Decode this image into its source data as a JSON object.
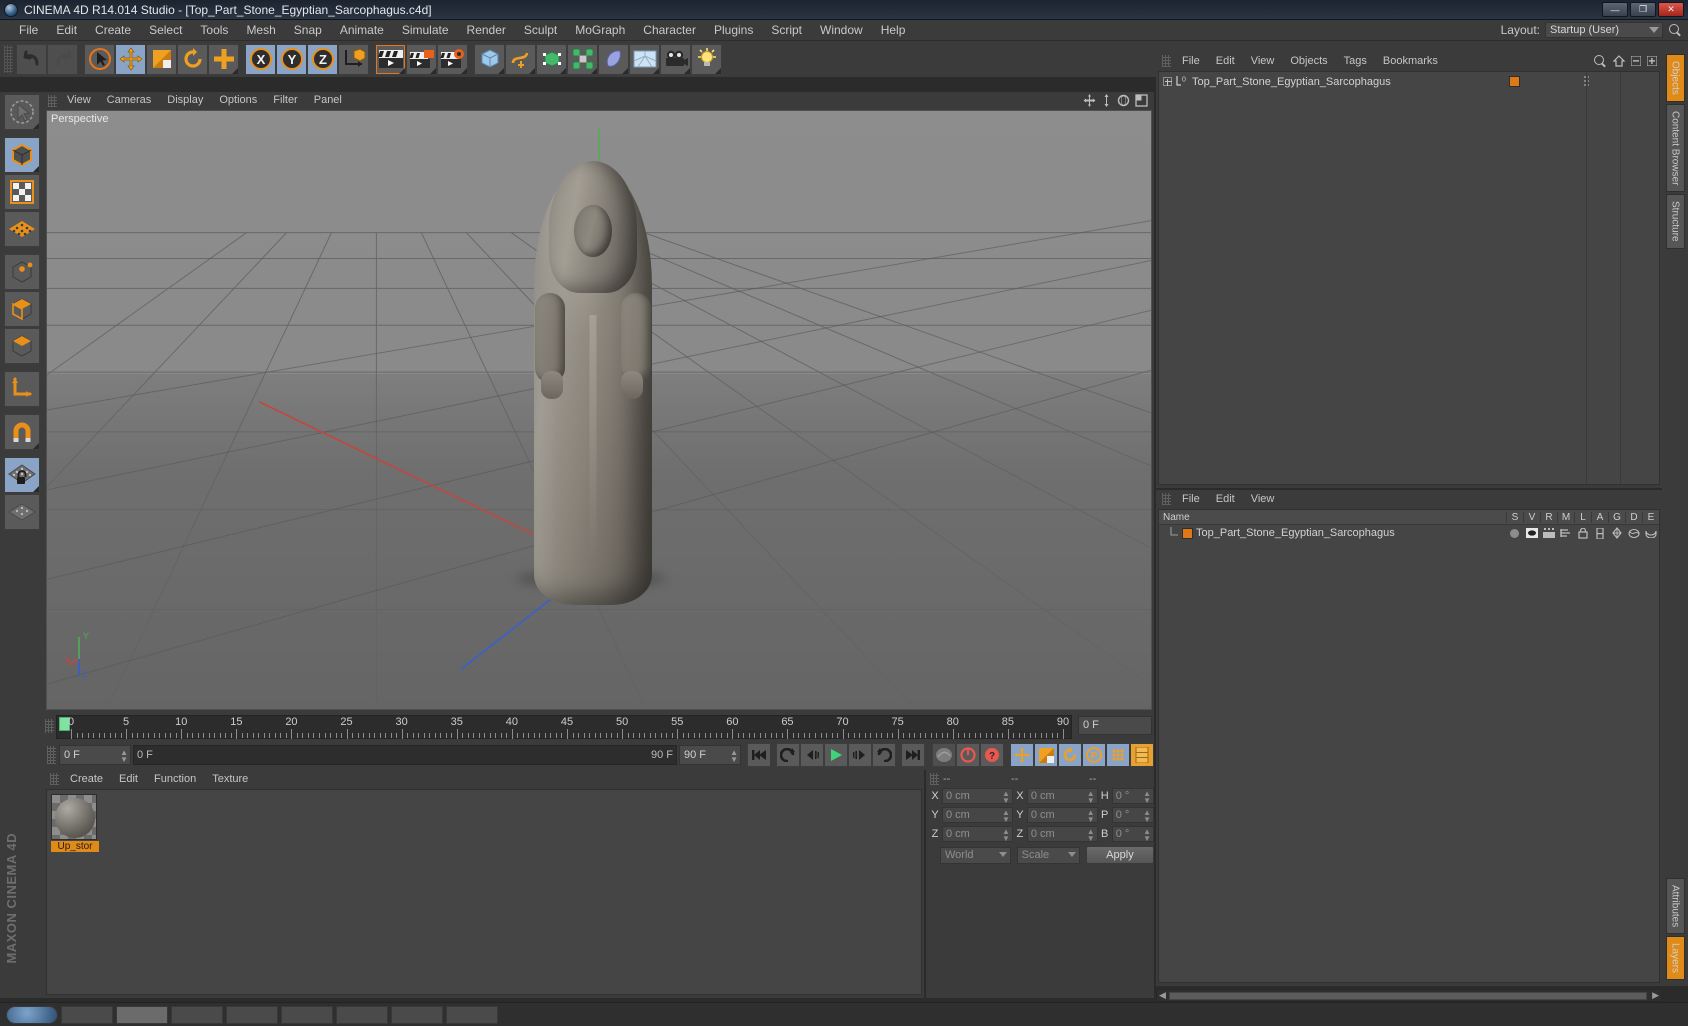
{
  "window": {
    "title": "CINEMA 4D R14.014 Studio - [Top_Part_Stone_Egyptian_Sarcophagus.c4d]",
    "app_icon": "c4d-logo-icon",
    "minimize": "—",
    "maximize": "❐",
    "close": "✕"
  },
  "menubar": {
    "items": [
      "File",
      "Edit",
      "Create",
      "Select",
      "Tools",
      "Mesh",
      "Snap",
      "Animate",
      "Simulate",
      "Render",
      "Sculpt",
      "MoGraph",
      "Character",
      "Plugins",
      "Script",
      "Window",
      "Help"
    ],
    "layout_label": "Layout:",
    "layout_value": "Startup (User)",
    "search_icon": "search-icon"
  },
  "toolbar": {
    "groups": [
      {
        "name": "history",
        "buttons": [
          {
            "icon": "undo-icon",
            "state": "dim",
            "dropdown": false
          },
          {
            "icon": "redo-icon",
            "state": "dim",
            "dropdown": false
          }
        ]
      },
      {
        "name": "transform-tools",
        "buttons": [
          {
            "icon": "select-arrow-icon",
            "state": "normal",
            "dropdown": true
          },
          {
            "icon": "move-icon",
            "state": "active",
            "dropdown": false
          },
          {
            "icon": "scale-icon",
            "state": "normal",
            "dropdown": false
          },
          {
            "icon": "rotate-icon",
            "state": "normal",
            "dropdown": false
          },
          {
            "icon": "plus-axis-icon",
            "state": "normal",
            "dropdown": true
          }
        ]
      },
      {
        "name": "axis-locks",
        "buttons": [
          {
            "icon": "x-axis-icon",
            "state": "active",
            "dropdown": false
          },
          {
            "icon": "y-axis-icon",
            "state": "active",
            "dropdown": false
          },
          {
            "icon": "z-axis-icon",
            "state": "active",
            "dropdown": false
          },
          {
            "icon": "world-object-axis-icon",
            "state": "normal",
            "dropdown": false
          }
        ]
      },
      {
        "name": "render",
        "buttons": [
          {
            "icon": "render-view-icon",
            "state": "highlight",
            "dropdown": true
          },
          {
            "icon": "render-region-icon",
            "state": "normal",
            "dropdown": true
          },
          {
            "icon": "render-settings-icon",
            "state": "normal",
            "dropdown": true
          }
        ]
      },
      {
        "name": "creation",
        "buttons": [
          {
            "icon": "cube-primitive-icon",
            "state": "normal",
            "dropdown": true
          },
          {
            "icon": "spline-pen-icon",
            "state": "normal",
            "dropdown": true
          },
          {
            "icon": "nurbs-icon",
            "state": "normal",
            "dropdown": true
          },
          {
            "icon": "array-modeling-icon",
            "state": "normal",
            "dropdown": true
          },
          {
            "icon": "deformer-icon",
            "state": "normal",
            "dropdown": true
          },
          {
            "icon": "environment-floor-icon",
            "state": "normal",
            "dropdown": true
          },
          {
            "icon": "camera-icon",
            "state": "normal",
            "dropdown": true
          },
          {
            "icon": "light-icon",
            "state": "normal",
            "dropdown": true
          }
        ]
      }
    ]
  },
  "left_toolbar": {
    "buttons": [
      {
        "icon": "live-selection-icon",
        "state": "normal",
        "dropdown": true
      },
      {
        "icon": "model-mode-icon",
        "state": "active",
        "dropdown": true
      },
      {
        "icon": "texture-mode-icon",
        "state": "normal",
        "dropdown": false
      },
      {
        "icon": "points-mode-icon",
        "state": "normal",
        "dropdown": false
      },
      {
        "icon": "edges-mode-icon",
        "state": "normal",
        "dropdown": false
      },
      {
        "icon": "polygons-mode-icon",
        "state": "normal",
        "dropdown": false
      },
      {
        "icon": "object-axis-mode-icon",
        "state": "normal",
        "dropdown": false
      },
      {
        "icon": "world-coordinates-icon",
        "state": "normal",
        "dropdown": false
      },
      {
        "icon": "magnet-icon",
        "state": "normal",
        "dropdown": true
      },
      {
        "icon": "lock-workplane-icon",
        "state": "active",
        "dropdown": true
      },
      {
        "icon": "workplane-icon",
        "state": "normal",
        "dropdown": false
      }
    ],
    "brand": "MAXON CINEMA 4D"
  },
  "viewport": {
    "menu": [
      "View",
      "Cameras",
      "Display",
      "Options",
      "Filter",
      "Panel"
    ],
    "label": "Perspective",
    "nav_icons": [
      "pan-icon",
      "zoom-icon",
      "rotate-view-icon",
      "maximize-view-icon"
    ],
    "axis_labels": {
      "x": "X",
      "y": "Y",
      "z": "Z"
    },
    "model_name": "Top_Part_Stone_Egyptian_Sarcophagus"
  },
  "timeline": {
    "ticks": [
      0,
      5,
      10,
      15,
      20,
      25,
      30,
      35,
      40,
      45,
      50,
      55,
      60,
      65,
      70,
      75,
      80,
      85,
      90
    ],
    "playhead_frame": "0",
    "end_field": "0 F"
  },
  "transport": {
    "current_frame": "0 F",
    "range_start": "0 F",
    "range_end": "90 F",
    "max_frame": "90 F",
    "buttons": [
      {
        "icon": "go-to-start-icon",
        "state": "normal"
      },
      {
        "icon": "previous-key-icon",
        "state": "normal"
      },
      {
        "icon": "step-back-icon",
        "state": "normal"
      },
      {
        "icon": "play-icon",
        "state": "normal"
      },
      {
        "icon": "step-forward-icon",
        "state": "normal"
      },
      {
        "icon": "next-key-icon",
        "state": "normal"
      },
      {
        "icon": "go-to-end-icon",
        "state": "normal"
      },
      {
        "icon": "record-active-objects-icon",
        "state": "dim"
      },
      {
        "icon": "autokeying-icon",
        "state": "normal"
      },
      {
        "icon": "keyframe-selection-icon",
        "state": "normal"
      },
      {
        "icon": "position-key-icon",
        "state": "active"
      },
      {
        "icon": "scale-key-icon",
        "state": "active"
      },
      {
        "icon": "rotation-key-icon",
        "state": "active"
      },
      {
        "icon": "parameter-key-icon",
        "state": "active"
      },
      {
        "icon": "point-level-animation-icon",
        "state": "active"
      },
      {
        "icon": "layout-key-icon",
        "state": "active"
      }
    ]
  },
  "material_manager": {
    "menu": [
      "Create",
      "Edit",
      "Function",
      "Texture"
    ],
    "materials": [
      {
        "name": "Up_stor",
        "preview": "stone-sphere-preview"
      }
    ]
  },
  "coordinates": {
    "headers": [
      "--",
      "--",
      "--"
    ],
    "rows": [
      {
        "label1": "X",
        "value1": "0 cm",
        "label2": "X",
        "value2": "0 cm",
        "label3": "H",
        "value3": "0 °"
      },
      {
        "label1": "Y",
        "value1": "0 cm",
        "label2": "Y",
        "value2": "0 cm",
        "label3": "P",
        "value3": "0 °"
      },
      {
        "label1": "Z",
        "value1": "0 cm",
        "label2": "Z",
        "value2": "0 cm",
        "label3": "B",
        "value3": "0 °"
      }
    ],
    "system": "World",
    "mode": "Scale",
    "apply": "Apply"
  },
  "object_manager": {
    "menu": [
      "File",
      "Edit",
      "View",
      "Objects",
      "Tags",
      "Bookmarks"
    ],
    "icons": [
      "search-icon",
      "home-icon",
      "collapse-icon",
      "expand-icon"
    ],
    "rows": [
      {
        "name": "Top_Part_Stone_Egyptian_Sarcophagus",
        "icon": "null-object-icon",
        "tag_color": "#e07818",
        "expandable": true
      }
    ]
  },
  "layer_manager": {
    "menu": [
      "File",
      "Edit",
      "View"
    ],
    "columns": [
      "Name",
      "S",
      "V",
      "R",
      "M",
      "L",
      "A",
      "G",
      "D",
      "E"
    ],
    "rows": [
      {
        "name": "Top_Part_Stone_Egyptian_Sarcophagus",
        "color": "#e07818"
      }
    ]
  },
  "right_tabs": [
    {
      "label": "Objects",
      "active": true
    },
    {
      "label": "Content Browser",
      "active": false
    },
    {
      "label": "Structure",
      "active": false
    },
    {
      "label": "Attributes",
      "active": false
    },
    {
      "label": "Layers",
      "active": true
    }
  ],
  "colors": {
    "accent_orange": "#e08a18",
    "active_blue": "#8aa4c8",
    "panel_bg": "#3b3b3b",
    "field_bg": "#4a4a4a",
    "x_axis": "#d24b43",
    "y_axis": "#62c462",
    "z_axis": "#4169e1"
  }
}
